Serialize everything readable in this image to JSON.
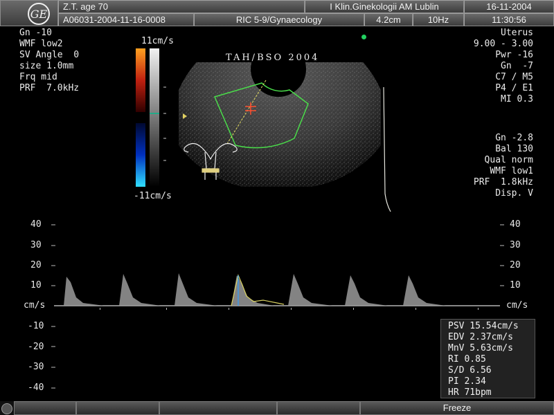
{
  "header": {
    "logo_text": "GE",
    "patient": "Z.T. age 70",
    "patient_id": "A06031-2004-11-16-0008",
    "institution": "I Klin.Ginekologii AM Lublin",
    "probe_app": "RIC 5-9/Gynaecology",
    "depth": "4.2cm",
    "frame_rate": "10Hz",
    "date": "16-11-2004",
    "time": "11:30:56"
  },
  "left_params": [
    "Gn -10",
    "WMF low2",
    "SV Angle  0",
    "size 1.0mm",
    "Frq mid",
    "PRF  7.0kHz"
  ],
  "right_params_top": [
    "Uterus",
    "9.00 - 3.00",
    "Pwr -16",
    "Gn  -7",
    "C7 / M5",
    "P4 / E1",
    "MI 0.3"
  ],
  "right_params_bottom": [
    "Gn -2.8",
    "Bal 130",
    "Qual norm",
    "WMF low1",
    "PRF  1.8kHz",
    "Disp. V"
  ],
  "color_bar": {
    "top_label": "11cm/s",
    "bottom_label": "-11cm/s"
  },
  "annotation": "TAH/BSO 2004",
  "scale": {
    "ticks": [
      "40",
      "30",
      "20",
      "10",
      "-10",
      "-20",
      "-30",
      "-40"
    ],
    "unit": "cm/s"
  },
  "measurements": [
    "PSV 15.54cm/s",
    "EDV 2.37cm/s",
    "MnV 5.63cm/s",
    "RI 0.85",
    "S/D 6.56",
    "PI 2.34",
    "HR 71bpm"
  ],
  "footer": {
    "freeze_label": "Freeze"
  }
}
